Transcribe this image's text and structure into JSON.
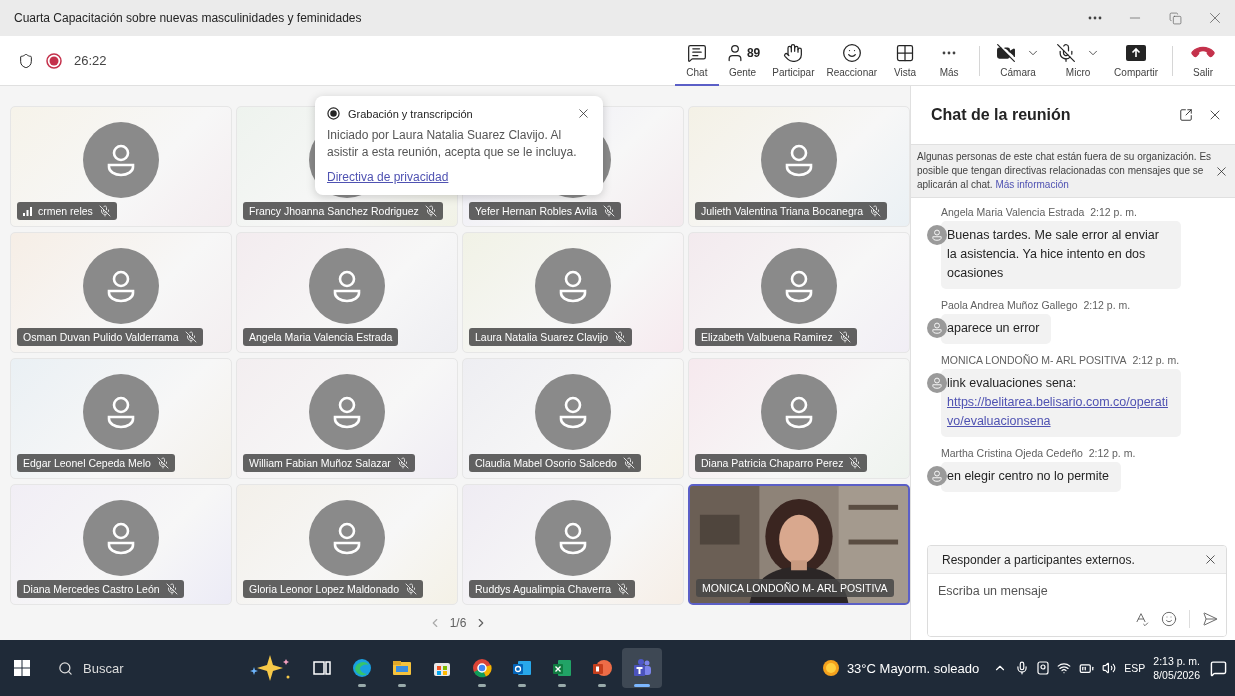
{
  "window": {
    "title": "Cuarta Capacitación sobre nuevas masculinidades y feminidades"
  },
  "meeting": {
    "timer": "26:22",
    "recording": true
  },
  "toolbar": [
    {
      "kind": "chat",
      "label": "Chat",
      "selected": true
    },
    {
      "kind": "people",
      "label": "Gente",
      "count": "89",
      "selected": false
    },
    {
      "kind": "raise",
      "label": "Participar",
      "selected": false
    },
    {
      "kind": "react",
      "label": "Reaccionar",
      "selected": false
    },
    {
      "kind": "view",
      "label": "Vista",
      "selected": false
    },
    {
      "kind": "more",
      "label": "Más",
      "selected": false
    },
    {
      "kind": "camera",
      "label": "Cámara",
      "off": true,
      "selected": false
    },
    {
      "kind": "mic",
      "label": "Micro",
      "off": true,
      "selected": false
    },
    {
      "kind": "share",
      "label": "Compartir",
      "selected": false
    },
    {
      "kind": "leave",
      "label": "Salir",
      "selected": false
    }
  ],
  "recording_notice": {
    "title": "Grabación y transcripción",
    "body": "Iniciado por Laura Natalia Suarez Clavijo. Al asistir a esta reunión, acepta que se le incluya.",
    "link": "Directiva de privacidad"
  },
  "participants": [
    {
      "name": "crmen reles",
      "kind": "avatar",
      "muted": true,
      "weak_signal": true,
      "highlighted": false
    },
    {
      "name": "Francy Jhoanna Sanchez Rodriguez",
      "kind": "covered",
      "muted": true,
      "weak_signal": false,
      "highlighted": false
    },
    {
      "name": "Yefer Hernan Robles Avila",
      "kind": "covered",
      "muted": true,
      "weak_signal": false,
      "highlighted": false
    },
    {
      "name": "Julieth Valentina Triana Bocanegra",
      "kind": "avatar",
      "muted": true,
      "weak_signal": false,
      "highlighted": false
    },
    {
      "name": "Osman Duvan Pulido Valderrama",
      "kind": "avatar",
      "muted": true,
      "weak_signal": false,
      "highlighted": false
    },
    {
      "name": "Angela Maria Valencia Estrada",
      "kind": "avatar",
      "muted": false,
      "weak_signal": false,
      "highlighted": false
    },
    {
      "name": "Laura Natalia Suarez Clavijo",
      "kind": "avatar",
      "muted": true,
      "weak_signal": false,
      "highlighted": false
    },
    {
      "name": "Elizabeth Valbuena Ramirez",
      "kind": "avatar",
      "muted": true,
      "weak_signal": false,
      "highlighted": false
    },
    {
      "name": "Edgar Leonel Cepeda Melo",
      "kind": "avatar",
      "muted": true,
      "weak_signal": false,
      "highlighted": false
    },
    {
      "name": "William Fabian Muñoz Salazar",
      "kind": "avatar",
      "muted": true,
      "weak_signal": false,
      "highlighted": false
    },
    {
      "name": "Claudia Mabel Osorio Salcedo",
      "kind": "avatar",
      "muted": true,
      "weak_signal": false,
      "highlighted": false
    },
    {
      "name": "Diana Patricia Chaparro Perez",
      "kind": "avatar",
      "muted": true,
      "weak_signal": false,
      "highlighted": false
    },
    {
      "name": "Diana Mercedes Castro León",
      "kind": "avatar",
      "muted": true,
      "weak_signal": false,
      "highlighted": false
    },
    {
      "name": "Gloria Leonor Lopez Maldonado",
      "kind": "avatar",
      "muted": true,
      "weak_signal": false,
      "highlighted": false
    },
    {
      "name": "Ruddys Agualimpia Chaverra",
      "kind": "avatar",
      "muted": true,
      "weak_signal": false,
      "highlighted": false
    },
    {
      "name": "MONICA LONDOÑO M- ARL POSITIVA",
      "kind": "picture",
      "muted": false,
      "weak_signal": false,
      "highlighted": true
    }
  ],
  "pagination": {
    "label": "1/6"
  },
  "chat": {
    "title": "Chat de la reunión",
    "notice": {
      "text": "Algunas personas de este chat están fuera de su organización. Es posible que tengan directivas relacionadas con mensajes que se aplicarán al chat.",
      "link": "Más información"
    },
    "messages": [
      {
        "sender": "Angela Maria Valencia Estrada",
        "time": "2:12 p. m.",
        "text": "Buenas tardes. Me sale error al enviar la asistencia. Ya hice intento en dos ocasiones"
      },
      {
        "sender": "Paola Andrea Muñoz Gallego",
        "time": "2:12 p. m.",
        "text": "aparece un error"
      },
      {
        "sender": "MONICA LONDOÑO M- ARL POSITIVA",
        "time": "2:12 p. m.",
        "text": "link evaluaciones sena:",
        "link": "https://belitarea.belisario.com.co/operativo/evaluacionsena"
      },
      {
        "sender": "Martha Cristina Ojeda Cedeño",
        "time": "2:12 p. m.",
        "text": "en elegir centro no lo permite"
      }
    ],
    "reply_banner": "Responder a participantes externos.",
    "composer": {
      "placeholder": "Escriba un mensaje"
    }
  },
  "taskbar": {
    "search": {
      "placeholder": "Buscar"
    },
    "apps": [
      {
        "kind": "taskview",
        "open": false,
        "selected": false
      },
      {
        "kind": "edge",
        "open": true,
        "selected": false
      },
      {
        "kind": "files",
        "open": true,
        "selected": false
      },
      {
        "kind": "store",
        "open": false,
        "selected": false
      },
      {
        "kind": "chrome",
        "open": true,
        "selected": false
      },
      {
        "kind": "outlook",
        "open": true,
        "selected": false
      },
      {
        "kind": "excel",
        "open": true,
        "selected": false
      },
      {
        "kind": "powerpoint",
        "open": true,
        "selected": false
      },
      {
        "kind": "teams",
        "open": true,
        "selected": true
      }
    ],
    "weather": {
      "temperature": "33°C",
      "condition": "Mayorm. soleado"
    },
    "language": "ESP",
    "time": "2:13 p. m.",
    "date": "8/05/2026"
  }
}
